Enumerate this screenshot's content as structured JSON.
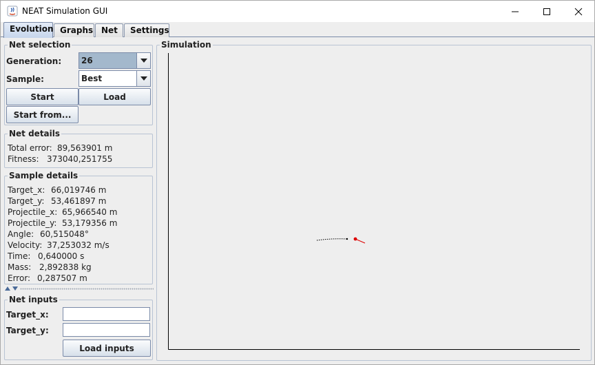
{
  "window": {
    "title": "NEAT Simulation GUI",
    "controls": [
      "minimize",
      "maximize",
      "close"
    ]
  },
  "tabs": [
    {
      "label": "Evolution",
      "active": true
    },
    {
      "label": "Graphs",
      "active": false
    },
    {
      "label": "Net",
      "active": false
    },
    {
      "label": "Settings",
      "active": false
    }
  ],
  "net_selection": {
    "title": "Net selection",
    "generation_label": "Generation:",
    "generation_value": "26",
    "sample_label": "Sample:",
    "sample_value": "Best",
    "start_label": "Start",
    "load_label": "Load",
    "start_from_label": "Start from..."
  },
  "net_details": {
    "title": "Net details",
    "rows": [
      {
        "label": "Total error:",
        "value": "89,563901 m"
      },
      {
        "label": "Fitness:",
        "value": "373040,251755"
      }
    ]
  },
  "sample_details": {
    "title": "Sample details",
    "rows": [
      {
        "label": "Target_x:",
        "value": "66,019746 m"
      },
      {
        "label": "Target_y:",
        "value": "53,461897 m"
      },
      {
        "label": "Projectile_x:",
        "value": "65,966540 m"
      },
      {
        "label": "Projectile_y:",
        "value": "53,179356 m"
      },
      {
        "label": "Angle:",
        "value": "60,515048°"
      },
      {
        "label": "Velocity:",
        "value": "37,253032 m/s"
      },
      {
        "label": "Time:",
        "value": "0,640000 s"
      },
      {
        "label": "Mass:",
        "value": "2,892838 kg"
      },
      {
        "label": "Error:",
        "value": "0,287507 m"
      }
    ]
  },
  "net_inputs": {
    "title": "Net inputs",
    "target_x_label": "Target_x:",
    "target_x_value": "",
    "target_y_label": "Target_y:",
    "target_y_value": "",
    "load_inputs_label": "Load inputs"
  },
  "simulation": {
    "title": "Simulation",
    "colors": {
      "axes": "#000000",
      "trajectory": "#000000",
      "projectile": "#dd0000"
    }
  }
}
